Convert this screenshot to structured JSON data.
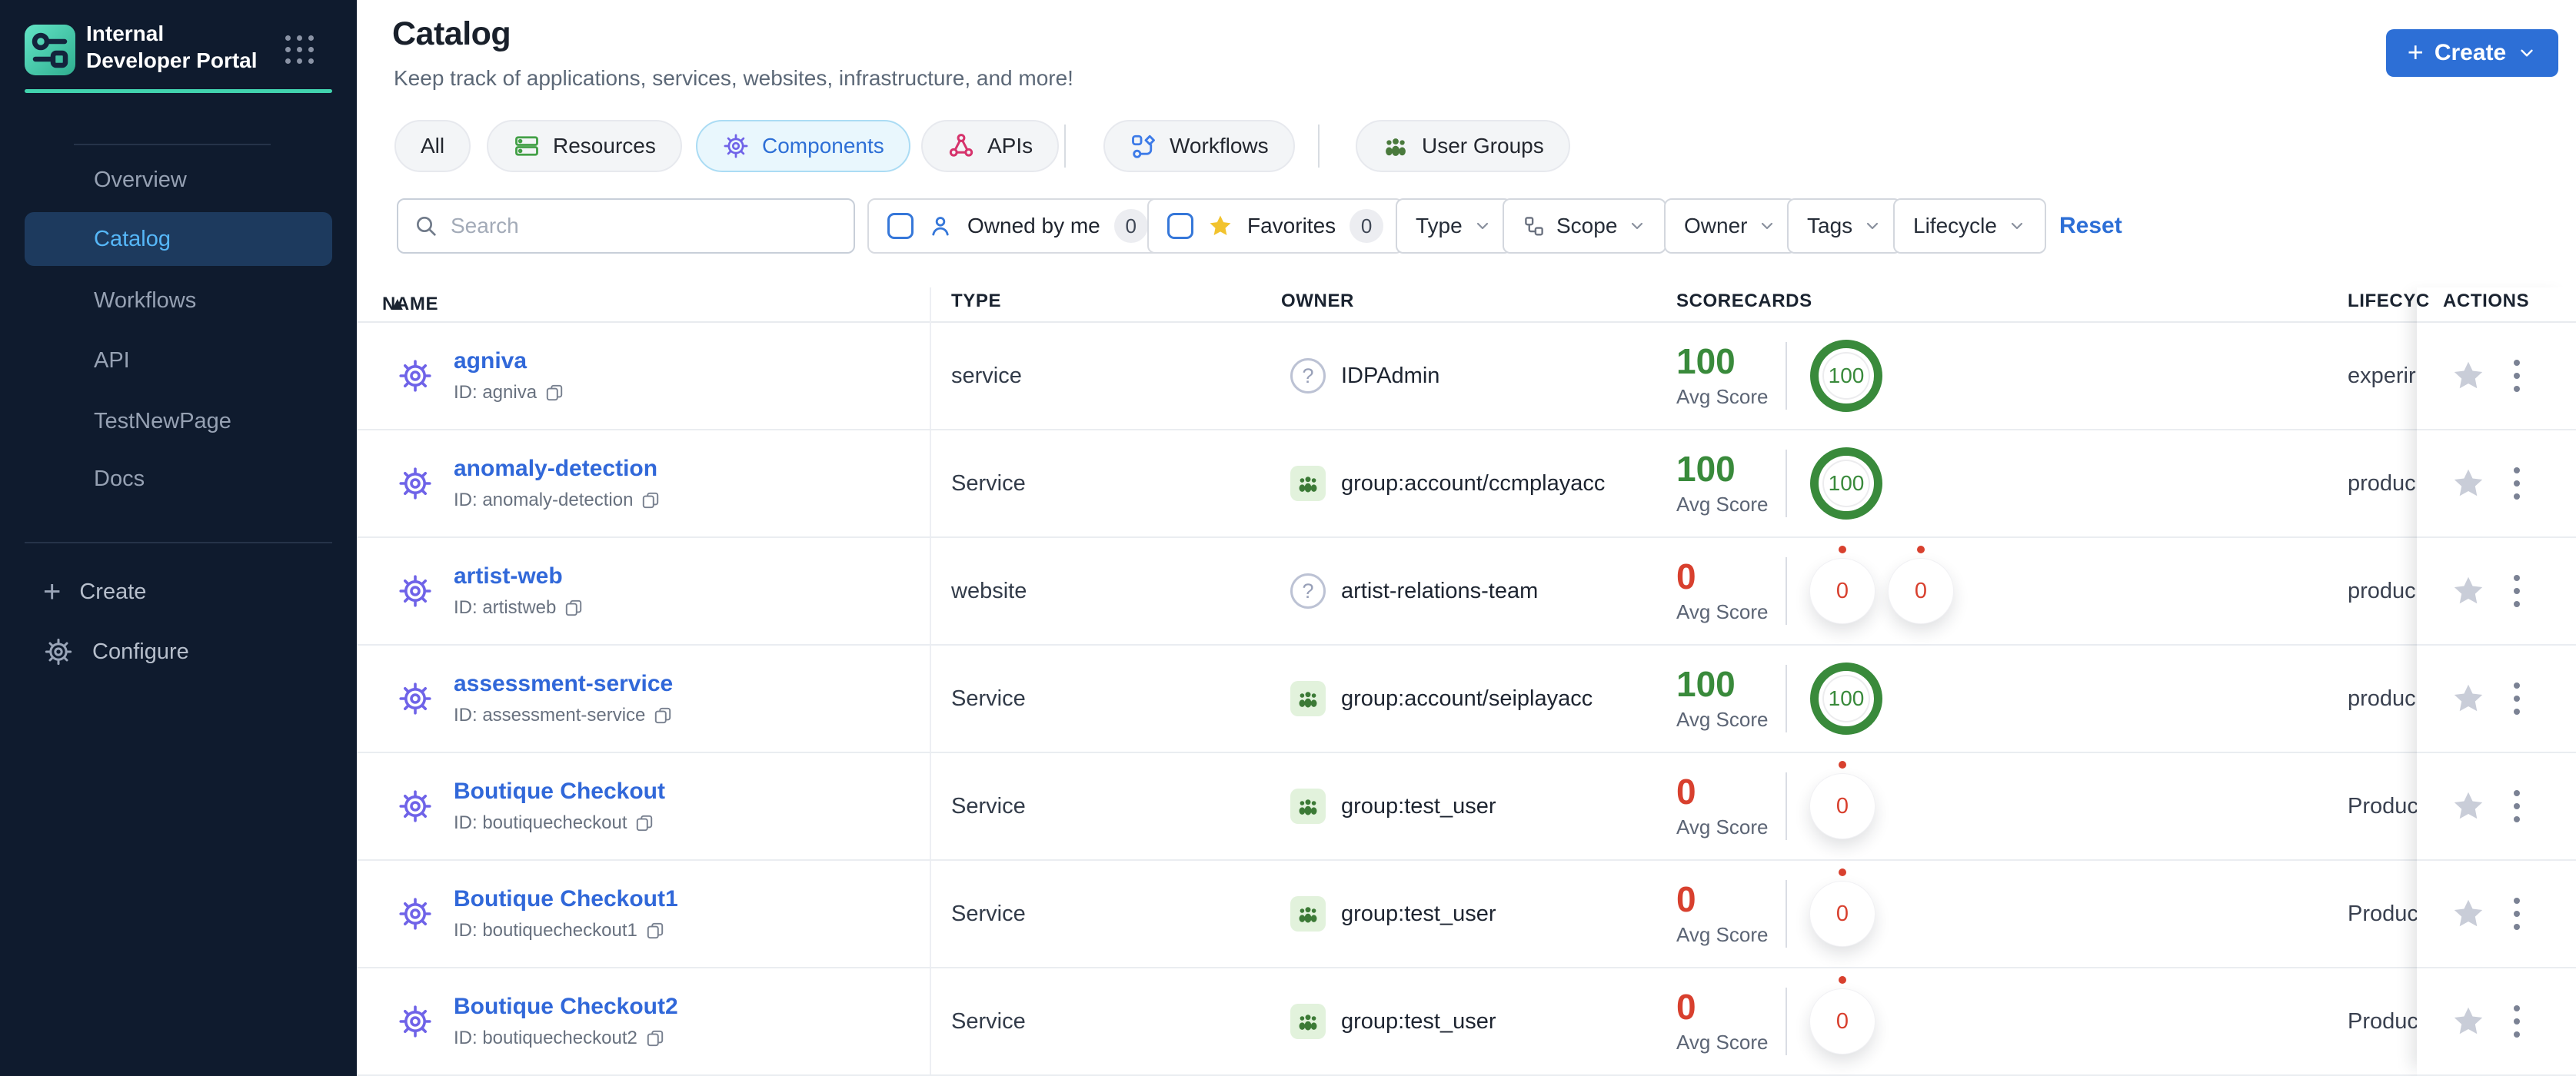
{
  "colors": {
    "accent_blue": "#2d6fd6",
    "sidebar_bg": "#0f1b2e",
    "sidebar_active_bg": "#1d3a5e",
    "sidebar_active_text": "#56b7f8",
    "teal": "#41d3ae",
    "score_green": "#398a3b",
    "score_red": "#d8402e",
    "tab_active_bg": "#e9f7fd",
    "tab_active_border": "#abdcf4",
    "gear_purple": "#6f63e8",
    "resources_green": "#43a047",
    "apis_crimson": "#d6336c",
    "workflows_blue": "#3d7be8",
    "groups_green": "#4a7a3d",
    "favorite_star": "#f2c32e"
  },
  "sidebar": {
    "brand": {
      "title": "Internal Developer Portal"
    },
    "items": [
      {
        "label": "Overview",
        "active": false
      },
      {
        "label": "Catalog",
        "active": true
      },
      {
        "label": "Workflows",
        "active": false
      },
      {
        "label": "API",
        "active": false
      },
      {
        "label": "TestNewPage",
        "active": false
      },
      {
        "label": "Docs",
        "active": false
      }
    ],
    "footer": {
      "create_label": "Create",
      "configure_label": "Configure"
    }
  },
  "header": {
    "title": "Catalog",
    "subtitle": "Keep track of applications, services, websites, infrastructure, and more!",
    "create_label": "Create"
  },
  "tabs": [
    {
      "label": "All",
      "active": false
    },
    {
      "label": "Resources",
      "active": false
    },
    {
      "label": "Components",
      "active": true
    },
    {
      "label": "APIs",
      "active": false
    },
    {
      "label": "Workflows",
      "active": false
    },
    {
      "label": "User Groups",
      "active": false
    }
  ],
  "filters": {
    "search_placeholder": "Search",
    "owned_by_me": {
      "label": "Owned by me",
      "count": "0"
    },
    "favorites": {
      "label": "Favorites",
      "count": "0"
    },
    "dropdowns": [
      {
        "label": "Type"
      },
      {
        "label": "Scope"
      },
      {
        "label": "Owner"
      },
      {
        "label": "Tags"
      },
      {
        "label": "Lifecycle"
      }
    ],
    "reset_label": "Reset"
  },
  "table": {
    "columns": [
      "NAME",
      "TYPE",
      "OWNER",
      "SCORECARDS",
      "LIFECYC",
      "ACTIONS"
    ],
    "avg_score_label": "Avg Score",
    "rows": [
      {
        "name": "agniva",
        "id": "ID: agniva",
        "type": "service",
        "owner": {
          "kind": "user",
          "label": "IDPAdmin"
        },
        "score": {
          "value": "100",
          "color": "green",
          "rings": [
            "100"
          ]
        },
        "lifecycle": "experir"
      },
      {
        "name": "anomaly-detection",
        "id": "ID: anomaly-detection",
        "type": "Service",
        "owner": {
          "kind": "group",
          "label": "group:account/ccmplayacc"
        },
        "score": {
          "value": "100",
          "color": "green",
          "rings": [
            "100"
          ]
        },
        "lifecycle": "produc"
      },
      {
        "name": "artist-web",
        "id": "ID: artistweb",
        "type": "website",
        "owner": {
          "kind": "user",
          "label": "artist-relations-team"
        },
        "score": {
          "value": "0",
          "color": "red",
          "rings": [
            "0",
            "0"
          ]
        },
        "lifecycle": "produc"
      },
      {
        "name": "assessment-service",
        "id": "ID: assessment-service",
        "type": "Service",
        "owner": {
          "kind": "group",
          "label": "group:account/seiplayacc"
        },
        "score": {
          "value": "100",
          "color": "green",
          "rings": [
            "100"
          ]
        },
        "lifecycle": "produc"
      },
      {
        "name": "Boutique Checkout",
        "id": "ID: boutiquecheckout",
        "type": "Service",
        "owner": {
          "kind": "group",
          "label": "group:test_user"
        },
        "score": {
          "value": "0",
          "color": "red",
          "rings": [
            "0"
          ]
        },
        "lifecycle": "Produc"
      },
      {
        "name": "Boutique Checkout1",
        "id": "ID: boutiquecheckout1",
        "type": "Service",
        "owner": {
          "kind": "group",
          "label": "group:test_user"
        },
        "score": {
          "value": "0",
          "color": "red",
          "rings": [
            "0"
          ]
        },
        "lifecycle": "Produc"
      },
      {
        "name": "Boutique Checkout2",
        "id": "ID: boutiquecheckout2",
        "type": "Service",
        "owner": {
          "kind": "group",
          "label": "group:test_user"
        },
        "score": {
          "value": "0",
          "color": "red",
          "rings": [
            "0"
          ]
        },
        "lifecycle": "Produc"
      }
    ]
  }
}
